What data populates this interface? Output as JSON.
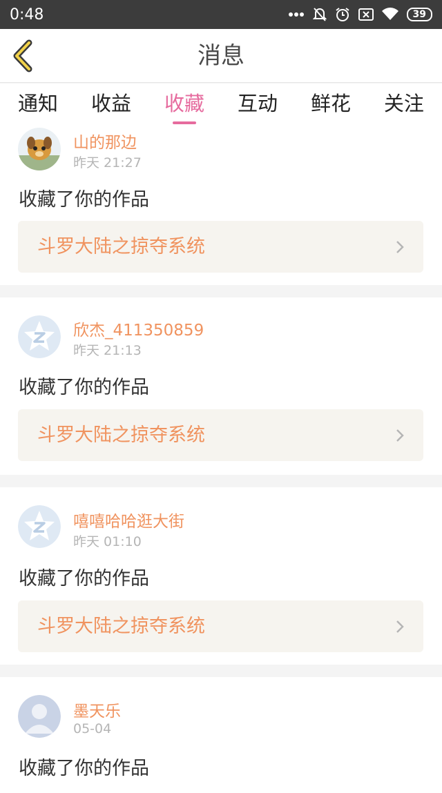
{
  "status": {
    "time": "0:48",
    "battery": "39"
  },
  "header": {
    "title": "消息"
  },
  "tabs": [
    "通知",
    "收益",
    "收藏",
    "互动",
    "鲜花",
    "关注"
  ],
  "active_tab": 2,
  "items": [
    {
      "name": "山的那边",
      "time": "昨天 21:27",
      "action": "收藏了你的作品",
      "work": "斗罗大陆之掠夺系统"
    },
    {
      "name": "欣杰_411350859",
      "time": "昨天 21:13",
      "action": "收藏了你的作品",
      "work": "斗罗大陆之掠夺系统"
    },
    {
      "name": "嘻嘻哈哈逛大街",
      "time": "昨天 01:10",
      "action": "收藏了你的作品",
      "work": "斗罗大陆之掠夺系统"
    },
    {
      "name": "墨天乐",
      "time": "05-04",
      "action": "收藏了你的作品"
    }
  ]
}
